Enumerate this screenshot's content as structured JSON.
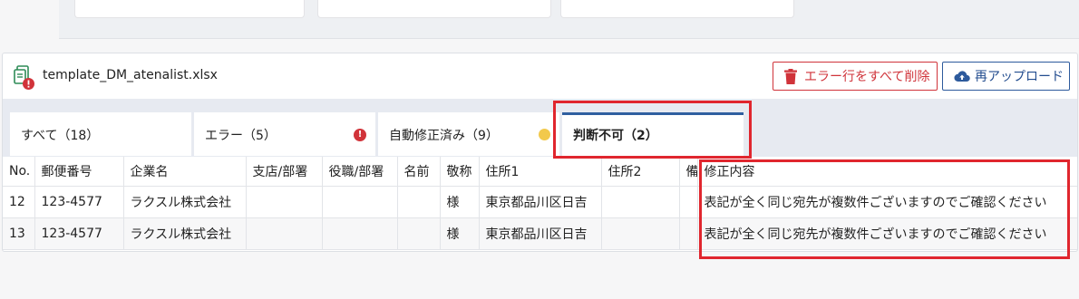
{
  "file": {
    "name": "template_DM_atenalist.xlsx"
  },
  "actions": {
    "delete_errors": "エラー行をすべて削除",
    "reupload": "再アップロード"
  },
  "tabs": [
    {
      "label": "すべて（18）"
    },
    {
      "label": "エラー（5）",
      "badge": "!"
    },
    {
      "label": "自動修正済み（9）"
    },
    {
      "label": "判断不可（2）"
    }
  ],
  "table": {
    "headers": [
      "No.",
      "郵便番号",
      "企業名",
      "支店/部署",
      "役職/部署",
      "名前",
      "敬称",
      "住所1",
      "住所2",
      "備考",
      "修正内容"
    ],
    "rows": [
      [
        "12",
        "123-4577",
        "ラクスル株式会社",
        "",
        "",
        "",
        "様",
        "東京都品川区日吉",
        "",
        "",
        "表記が全く同じ宛先が複数件ございますのでご確認ください"
      ],
      [
        "13",
        "123-4577",
        "ラクスル株式会社",
        "",
        "",
        "",
        "様",
        "東京都品川区日吉",
        "",
        "",
        "表記が全く同じ宛先が複数件ございますのでご確認ください"
      ]
    ]
  },
  "colors": {
    "error": "#d1333a",
    "warning": "#f2c94c",
    "accent": "#2f5fa0",
    "highlight": "#e0262e"
  }
}
